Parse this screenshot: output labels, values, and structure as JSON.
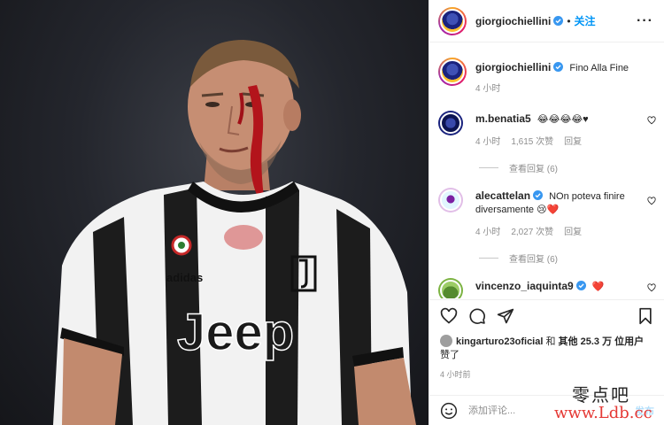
{
  "header": {
    "username": "giorgiochiellini",
    "dot": "•",
    "follow_label": "关注",
    "more_label": "···"
  },
  "caption": {
    "username": "giorgiochiellini",
    "text": "Fino Alla Fine",
    "time": "4 小时"
  },
  "comments": [
    {
      "username": "m.benatia5",
      "text": "😂😂😂😂♥",
      "time": "4 小时",
      "likes": "1,615 次赞",
      "reply_label": "回复",
      "view_replies": "查看回复 (6)"
    },
    {
      "username": "alecattelan",
      "text": "NOn poteva finire diversamente 😢❤️",
      "time": "4 小时",
      "likes": "2,027 次赞",
      "reply_label": "回复",
      "view_replies": "查看回复 (6)"
    },
    {
      "username": "vincenzo_iaquinta9",
      "text": "❤️"
    }
  ],
  "likes": {
    "user": "kingarturo23oficial",
    "conj": "和",
    "others": "其他 25.3 万 位用户",
    "suffix": "赞了"
  },
  "post_time": "4 小时前",
  "add_comment": {
    "placeholder": "添加评论...",
    "post_label": "发布"
  },
  "watermark": {
    "line1": "零点吧",
    "line2": "www.Ldb.cc"
  },
  "photo_text": {
    "jersey_sponsor": "Jeep",
    "jersey_brand": "adidas"
  },
  "colors": {
    "verified_blue": "#3897f0",
    "follow_blue": "#0095f6",
    "heart_red": "#ed4956"
  }
}
